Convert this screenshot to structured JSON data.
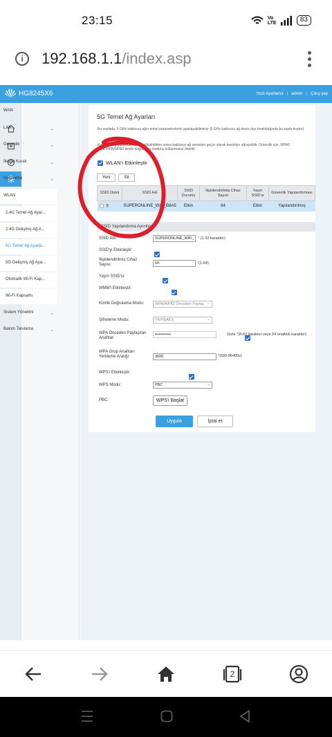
{
  "status_bar": {
    "time": "23:15",
    "network_label": "Vo LTE",
    "battery": "83"
  },
  "browser": {
    "url_host": "192.168.1.1",
    "url_path": "/index.asp",
    "tab_count": "2",
    "icons": {
      "info": "info-icon",
      "menu": "kebab-menu-icon",
      "back": "back-arrow-icon",
      "forward": "forward-arrow-icon",
      "home": "home-icon",
      "tabs": "tabs-icon",
      "profile": "profile-icon"
    }
  },
  "router": {
    "brand": "HG8245X6",
    "header_links": [
      "Hızlı Ayarlama",
      "admin",
      "Çıkış yap"
    ],
    "rail_icons": [
      "home-icon",
      "add-box-icon",
      "check-circle-icon",
      "settings-icon"
    ],
    "nav": [
      {
        "label": "WAN",
        "chev": false
      },
      {
        "label": "LAN",
        "chev": true
      },
      {
        "label": "Güvenlik",
        "chev": true
      },
      {
        "label": "İletme Kuralı",
        "chev": true
      },
      {
        "label": "Uygulama",
        "chev": true
      },
      {
        "label": "WLAN",
        "chev": false
      },
      {
        "label": "2.4G Temel Ağ Ayar...",
        "chev": false
      },
      {
        "label": "2.4G Gelişmiş Ağ A...",
        "chev": false
      },
      {
        "label": "5G Temel Ağ Ayarla...",
        "chev": false
      },
      {
        "label": "5G Gelişmiş Ağ Aya...",
        "chev": false
      },
      {
        "label": "Otomatik Wi-Fi Kap...",
        "chev": false
      },
      {
        "label": "Wi-Fi Kapsamı",
        "chev": false
      },
      {
        "label": "Sistem Yönetimi",
        "chev": true
      },
      {
        "label": "Bakım Tanılama",
        "chev": true
      }
    ],
    "page_title": "5G Temel Ağ Ayarları",
    "description": "Bu sayfada, 5 GHz kablosuz ağın temel parametrelerini ayarlayabilirsiniz (5 GHz kablosuz ağ devre dışı bırakıldığında bu sayfa boştur).",
    "note": "Kablosuz ağ parametrelerini değiştirdikten sonra kablosuz ağ servisleri geçici olarak kesintiye uğrayabilir. Güvenlik için, WPA2 veya WPA/WPA2 kimlik doğrulama modunu kullanmanız önerilir.",
    "wlan_enable_label": "WLAN'ı Etkinleştir",
    "new_button": "Yeni",
    "delete_button": "Sil",
    "table": {
      "headers": [
        "SSID Dizini",
        "SSID Adı",
        "SSID Durumu",
        "İlişkilendirilmiş Cihaz Sayısı",
        "Yayın SSID'si",
        "Güvenlik Yapılandırması"
      ],
      "rows": [
        [
          "5",
          "SUPERONLINE_WiFi_B8A5",
          "Etkin",
          "64",
          "Etkin",
          "Yapılandırılmış"
        ]
      ]
    },
    "details_header": "SSID Yapılandırma Ayrıntıları",
    "form": {
      "ssid_name_label": "SSID Adı:",
      "ssid_name_value": "SUPERONLINE_WiFi_",
      "ssid_name_hint": "(1-32 karakter)",
      "enable_ssid_label": "SSID'yi Etkinleştir:",
      "assoc_label": "İlişkilendirilmiş Cihaz Sayısı:",
      "assoc_value": "64",
      "assoc_hint": "(1-64)",
      "broadcast_label": "Yayın SSID'si:",
      "wmm_label": "WMM'i Etkinleştir:",
      "auth_label": "Kimlik Doğrulama Modu:",
      "auth_value": "WPA/WPA2 Önceden Paylaş",
      "encrypt_label": "Şifreleme Modu:",
      "encrypt_value": "TKIP&AES",
      "psk_label": "WPA Önceden Paylaşılan Anahtar:",
      "psk_value": "••••••••••••",
      "psk_hide": "Gizle",
      "psk_hint": "(8-63 karakter veya 64 onaltılık karakter)",
      "rekey_label": "WPA Grup Anahtarı Yenileme Aralığı:",
      "rekey_value": "3600",
      "rekey_hint": "(600-86400s)",
      "wps_enable_label": "WPS'i Etkinleştir:",
      "wps_mode_label": "WPS Modu:",
      "wps_mode_value": "PBC",
      "pbc_label": "PBC:",
      "pbc_button": "WPS'i Başlat"
    },
    "apply_button": "Uygula",
    "cancel_button": "İptal et"
  },
  "annotation_color": "#e01d2a"
}
